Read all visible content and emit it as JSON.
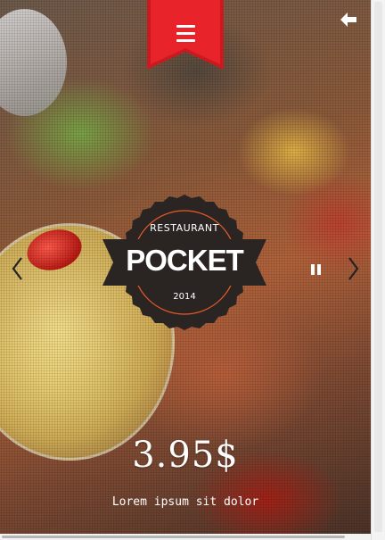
{
  "slide": {
    "logo_top": "RESTAURANT",
    "logo_main": "POCKET",
    "logo_year": "2014",
    "price": "3.95$",
    "caption": "Lorem ipsum sit dolor"
  },
  "icons": {
    "menu": "hamburger-menu-icon",
    "back": "back-arrow-icon",
    "prev": "chevron-left-icon",
    "next": "chevron-right-icon",
    "pause": "pause-icon"
  },
  "colors": {
    "ribbon": "#e8232a",
    "logo_badge": "#2a2523",
    "logo_ring": "#e85a2a"
  }
}
